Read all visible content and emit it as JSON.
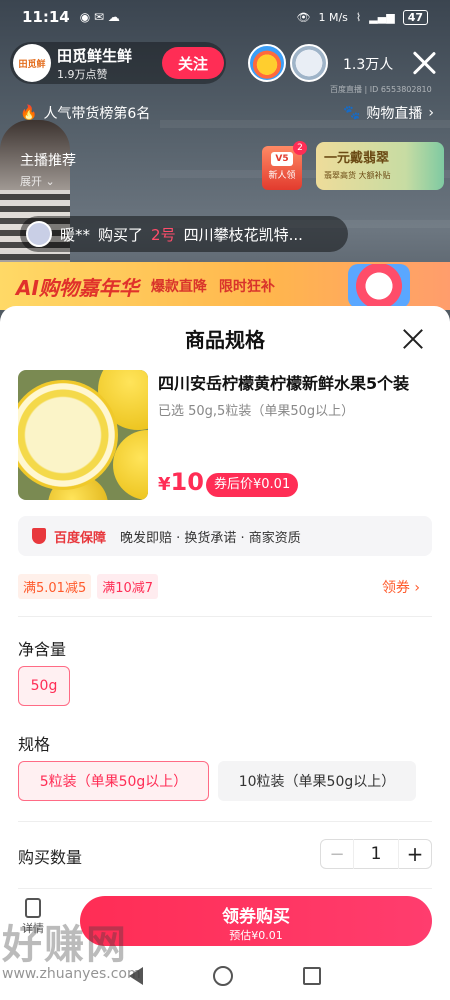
{
  "status_bar": {
    "time": "11:14",
    "net_speed": "1 M/s",
    "battery": "47"
  },
  "live": {
    "anchor_name": "田觅鲜生鲜",
    "anchor_likes": "1.9万点赞",
    "anchor_avatar_text": "田觅鲜",
    "follow_label": "关注",
    "viewer_count": "1.3万人",
    "room_id": "百度直播 | ID 6553802810",
    "rank_text": "人气带货榜第6名",
    "shop_live_label": "购物直播",
    "recommend_title": "主播推荐",
    "recommend_expand": "展开",
    "gift_badge_count": "2",
    "gift_badge_level": "V5",
    "gift_badge_label": "新人领",
    "jade_banner_title": "一元戴翡翠",
    "jade_banner_sub": "翡翠高货 大额补贴",
    "purchase_user": "暖**",
    "purchase_action": "购买了",
    "purchase_num": "2号",
    "purchase_item": "四川攀枝花凯特...",
    "carnival_title": "AI购物嘉年华",
    "carnival_sub1": "爆款直降",
    "carnival_sub2": "限时狂补"
  },
  "sheet": {
    "title": "商品规格",
    "product_title": "四川安岳柠檬黄柠檬新鲜水果5个装",
    "selected_text": "已选 50g,5粒装（单果50g以上）",
    "price_currency": "¥",
    "price_value": "10",
    "coupon_price": "券后价¥0.01",
    "guarantee_brand": "百度保障",
    "guarantee_text": "晚发即赔 · 换货承诺 · 商家资质",
    "promo_1": "满5.01减5",
    "promo_2": "满10减7",
    "get_coupon_label": "领券 ›",
    "net_label": "净含量",
    "net_options": [
      "50g"
    ],
    "spec_label": "规格",
    "spec_options": [
      "5粒装（单果50g以上）",
      "10粒装（单果50g以上）"
    ],
    "qty_label": "购买数量",
    "qty_minus": "−",
    "qty_value": "1",
    "qty_plus": "+",
    "detail_label": "详情",
    "buy_label": "领券购买",
    "buy_sub": "预估¥0.01"
  },
  "watermark": {
    "text": "好赚网",
    "url": "www.zhuanyes.com"
  },
  "colors": {
    "accent": "#ff2d55",
    "orange": "#ff5a2b"
  }
}
